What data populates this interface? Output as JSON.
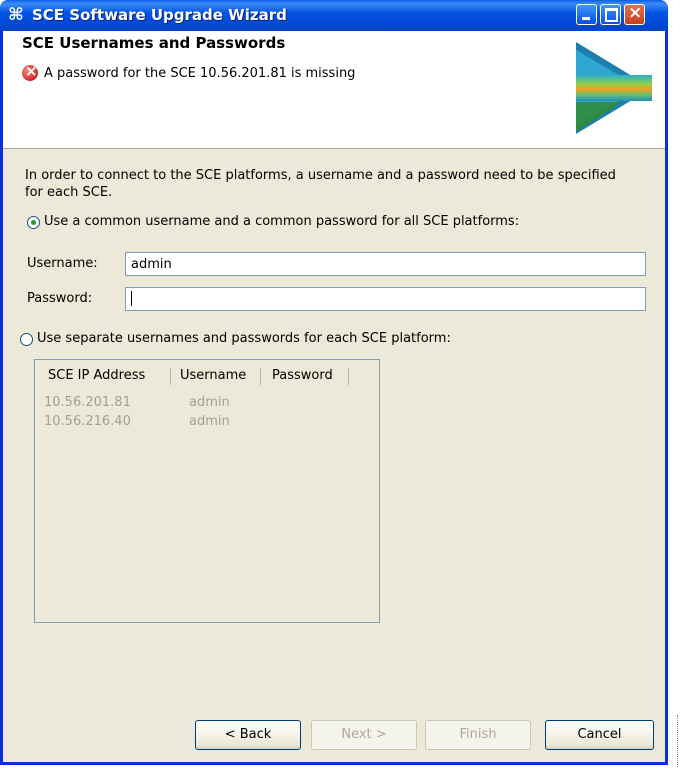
{
  "window": {
    "title": "SCE Software Upgrade Wizard",
    "icon": "⌘"
  },
  "header": {
    "title": "SCE Usernames and Passwords",
    "error_message": "A password for the SCE 10.56.201.81 is missing"
  },
  "intro_text": "In order to connect to the SCE platforms, a username and a password need to be specified for each SCE.",
  "options": {
    "common_label": "Use a common username and a common password for all SCE platforms:",
    "common_selected": true,
    "separate_label": "Use separate usernames and passwords for each SCE platform:",
    "separate_selected": false
  },
  "fields": {
    "username_label": "Username:",
    "username_value": "admin",
    "password_label": "Password:",
    "password_value": ""
  },
  "table": {
    "columns": [
      "SCE IP Address",
      "Username",
      "Password"
    ],
    "rows": [
      {
        "ip": "10.56.201.81",
        "username": "admin",
        "password": ""
      },
      {
        "ip": "10.56.216.40",
        "username": "admin",
        "password": ""
      }
    ]
  },
  "buttons": {
    "back": "< Back",
    "next": "Next >",
    "finish": "Finish",
    "cancel": "Cancel"
  },
  "colors": {
    "titlebar": "#0555e5",
    "dialog_bg": "#ece9d8",
    "error": "#d42525"
  }
}
